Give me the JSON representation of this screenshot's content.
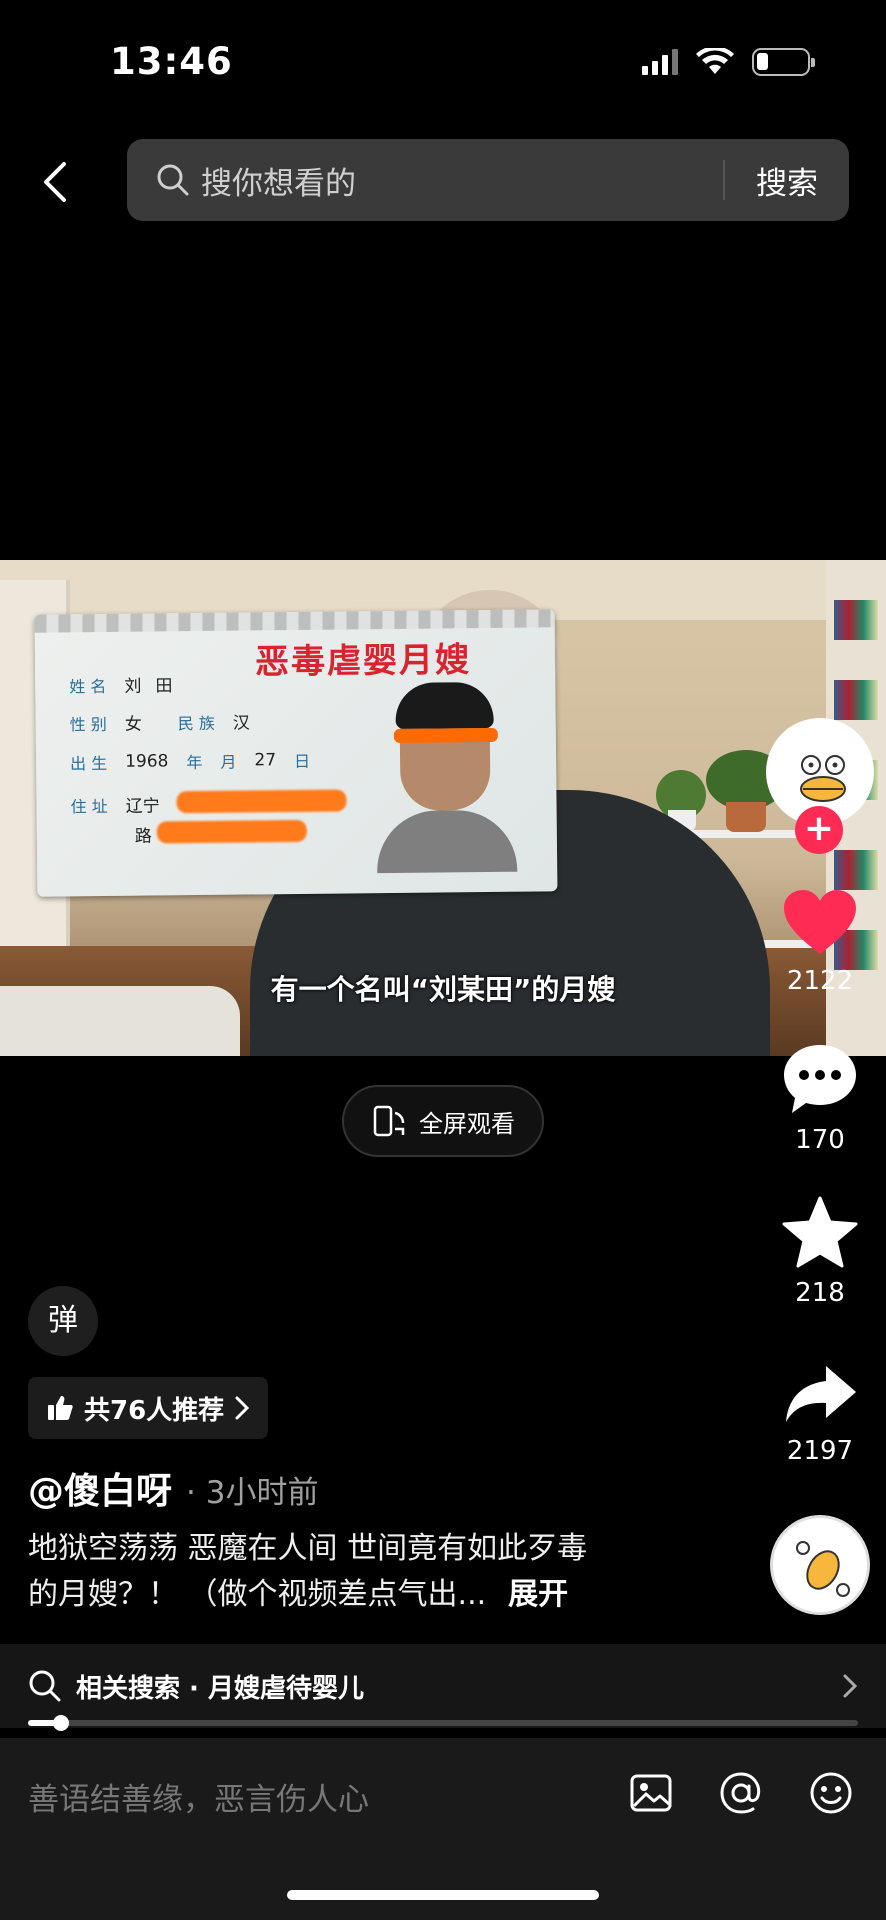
{
  "status": {
    "time": "13:46"
  },
  "search": {
    "placeholder": "搜你想看的",
    "submit_label": "搜索"
  },
  "video": {
    "card_title": "恶毒虐婴月嫂",
    "card": {
      "name_label": "姓 名",
      "name_value": "刘",
      "name_suffix": "田",
      "sex_label": "性 别",
      "sex_value": "女",
      "ethnic_label": "民 族",
      "ethnic_value": "汉",
      "birth_label": "出 生",
      "birth_year": "1968",
      "year_label": "年",
      "month_label": "月",
      "day_value": "27",
      "day_label": "日",
      "addr_label": "住 址",
      "addr_value1": "辽宁",
      "addr_value2": "路"
    },
    "subtitle": "有一个名叫“刘某田”的月嫂"
  },
  "fullscreen": {
    "label": "全屏观看"
  },
  "rail": {
    "likes": "2122",
    "comments": "170",
    "favorites": "218",
    "shares": "2197"
  },
  "danmu": {
    "label": "弹"
  },
  "recommend": {
    "label": "共76人推荐"
  },
  "post": {
    "author": "@傻白呀",
    "time": "· 3小时前",
    "desc_line1": "地狱空荡荡 恶魔在人间 世间竟有如此歹毒",
    "desc_line2": "的月嫂？！ （做个视频差点气出...",
    "expand": "展开"
  },
  "related": {
    "label": "相关搜索 · 月嫂虐待婴儿"
  },
  "progress": {
    "fraction": 0.04
  },
  "comment": {
    "placeholder": "善语结善缘，恶言伤人心"
  },
  "colors": {
    "accent": "#fe2c55",
    "like": "#fe2c55",
    "card_title": "#d9242f"
  },
  "icons": [
    "chevron-left-icon",
    "search-icon",
    "wifi-icon",
    "signal-icon",
    "battery-icon",
    "plus-icon",
    "heart-icon",
    "comment-icon",
    "star-icon",
    "share-icon",
    "thumb-up-icon",
    "chevron-right-icon",
    "image-icon",
    "at-icon",
    "emoji-icon",
    "rotate-phone-icon"
  ]
}
